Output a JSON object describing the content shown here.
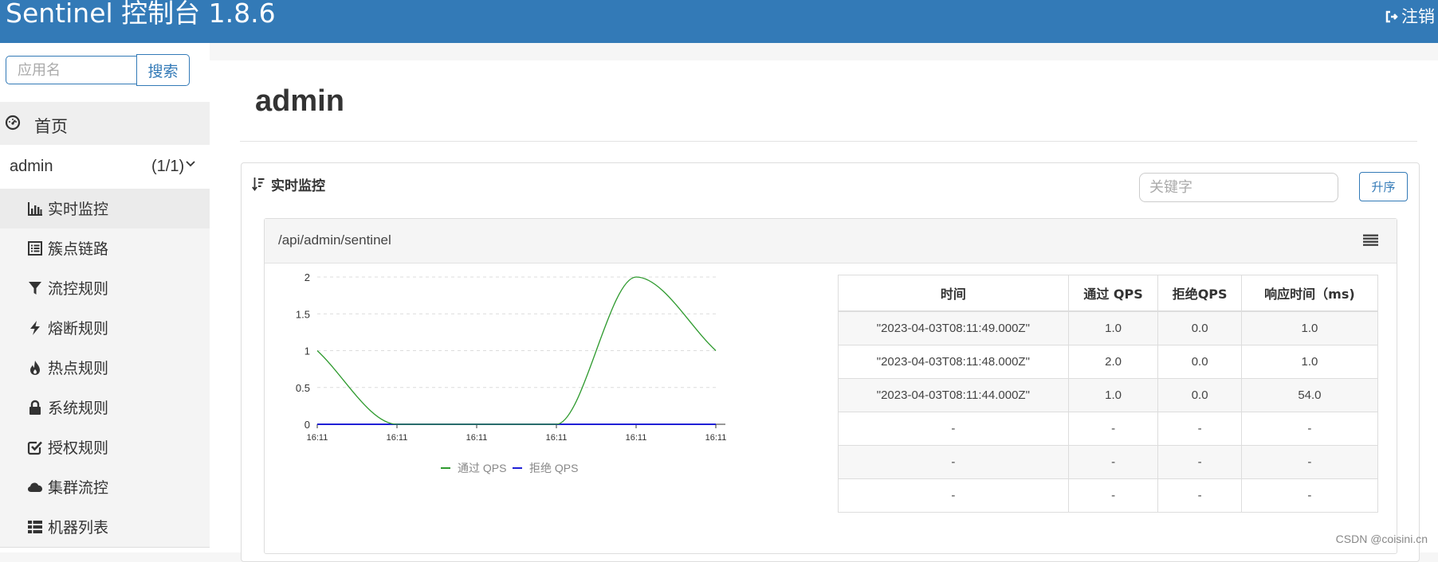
{
  "header": {
    "title": "Sentinel 控制台 1.8.6",
    "logout_label": "注销",
    "bg_color": "#337ab7"
  },
  "sidebar": {
    "search": {
      "placeholder": "应用名",
      "button_label": "搜索"
    },
    "home": {
      "label": "首页",
      "icon": "dashboard-icon"
    },
    "app": {
      "name": "admin",
      "count": "(1/1)"
    },
    "menu": [
      {
        "label": "实时监控",
        "icon": "bar-chart-icon",
        "active": true
      },
      {
        "label": "簇点链路",
        "icon": "list-alt-icon"
      },
      {
        "label": "流控规则",
        "icon": "filter-icon"
      },
      {
        "label": "熔断规则",
        "icon": "flash-icon"
      },
      {
        "label": "热点规则",
        "icon": "fire-icon"
      },
      {
        "label": "系统规则",
        "icon": "lock-icon"
      },
      {
        "label": "授权规则",
        "icon": "check-icon"
      },
      {
        "label": "集群流控",
        "icon": "cloud-icon"
      },
      {
        "label": "机器列表",
        "icon": "th-list-icon"
      }
    ]
  },
  "main": {
    "title": "admin",
    "panel": {
      "title": "实时监控",
      "keyword_placeholder": "关键字",
      "sort_label": "升序"
    },
    "resource": {
      "name": "/api/admin/sentinel"
    }
  },
  "chart_data": {
    "type": "line",
    "x": [
      "16:11",
      "16:11",
      "16:11",
      "16:11",
      "16:11",
      "16:11"
    ],
    "y_ticks": [
      0,
      0.5,
      1,
      1.5,
      2
    ],
    "ylim": [
      0,
      2
    ],
    "grid": true,
    "legend_position": "bottom",
    "series": [
      {
        "name": "通过 QPS",
        "color": "#2e9a2e",
        "values": [
          1,
          0,
          0,
          0,
          2,
          1
        ]
      },
      {
        "name": "拒绝 QPS",
        "color": "#1f1fd6",
        "values": [
          0,
          0,
          0,
          0,
          0,
          0
        ]
      }
    ]
  },
  "table": {
    "headers": [
      "时间",
      "通过 QPS",
      "拒绝QPS",
      "响应时间（ms)"
    ],
    "rows": [
      [
        "\"2023-04-03T08:11:49.000Z\"",
        "1.0",
        "0.0",
        "1.0"
      ],
      [
        "\"2023-04-03T08:11:48.000Z\"",
        "2.0",
        "0.0",
        "1.0"
      ],
      [
        "\"2023-04-03T08:11:44.000Z\"",
        "1.0",
        "0.0",
        "54.0"
      ],
      [
        "-",
        "-",
        "-",
        "-"
      ],
      [
        "-",
        "-",
        "-",
        "-"
      ],
      [
        "-",
        "-",
        "-",
        "-"
      ]
    ]
  },
  "watermark": "CSDN @coisini.cn"
}
